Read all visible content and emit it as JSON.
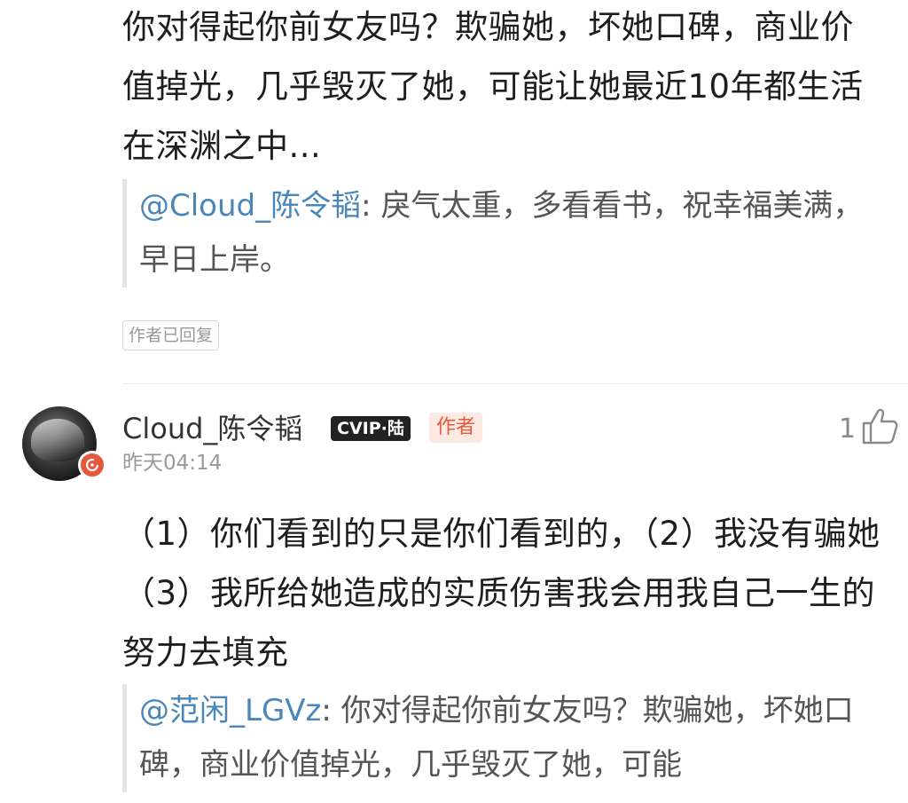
{
  "top_comment": {
    "text": "你对得起你前女友吗？欺骗她，坏她口碑，商业价值掉光，几乎毁灭了她，可能让她最近10年都生活在深渊之中...",
    "quote_mention": "@Cloud_陈令韬",
    "quote_text": ": 戾气太重，多看看书，祝幸福美满，早日上岸。",
    "reply_badge": "作者已回复"
  },
  "reply": {
    "username": "Cloud_陈令韬",
    "vip_badge": "CVIP·陆",
    "author_badge": "作者",
    "timestamp": "昨天04:14",
    "like_count": "1",
    "text": "（1）你们看到的只是你们看到的，（2）我没有骗她（3）我所给她造成的实质伤害我会用我自己一生的努力去填充",
    "quote_mention": "@范闲_LGVz",
    "quote_text": ": 你对得起你前女友吗？欺骗她，坏她口碑，商业价值掉光，几乎毁灭了她，可能"
  },
  "icons": {
    "avatar_badge": "refresh-circle-icon",
    "like": "thumbs-up-icon"
  },
  "colors": {
    "mention": "#4a86b8",
    "author_badge_bg": "#fde9e4",
    "author_badge_text": "#e15a3c",
    "avatar_badge": "#e8563e"
  }
}
